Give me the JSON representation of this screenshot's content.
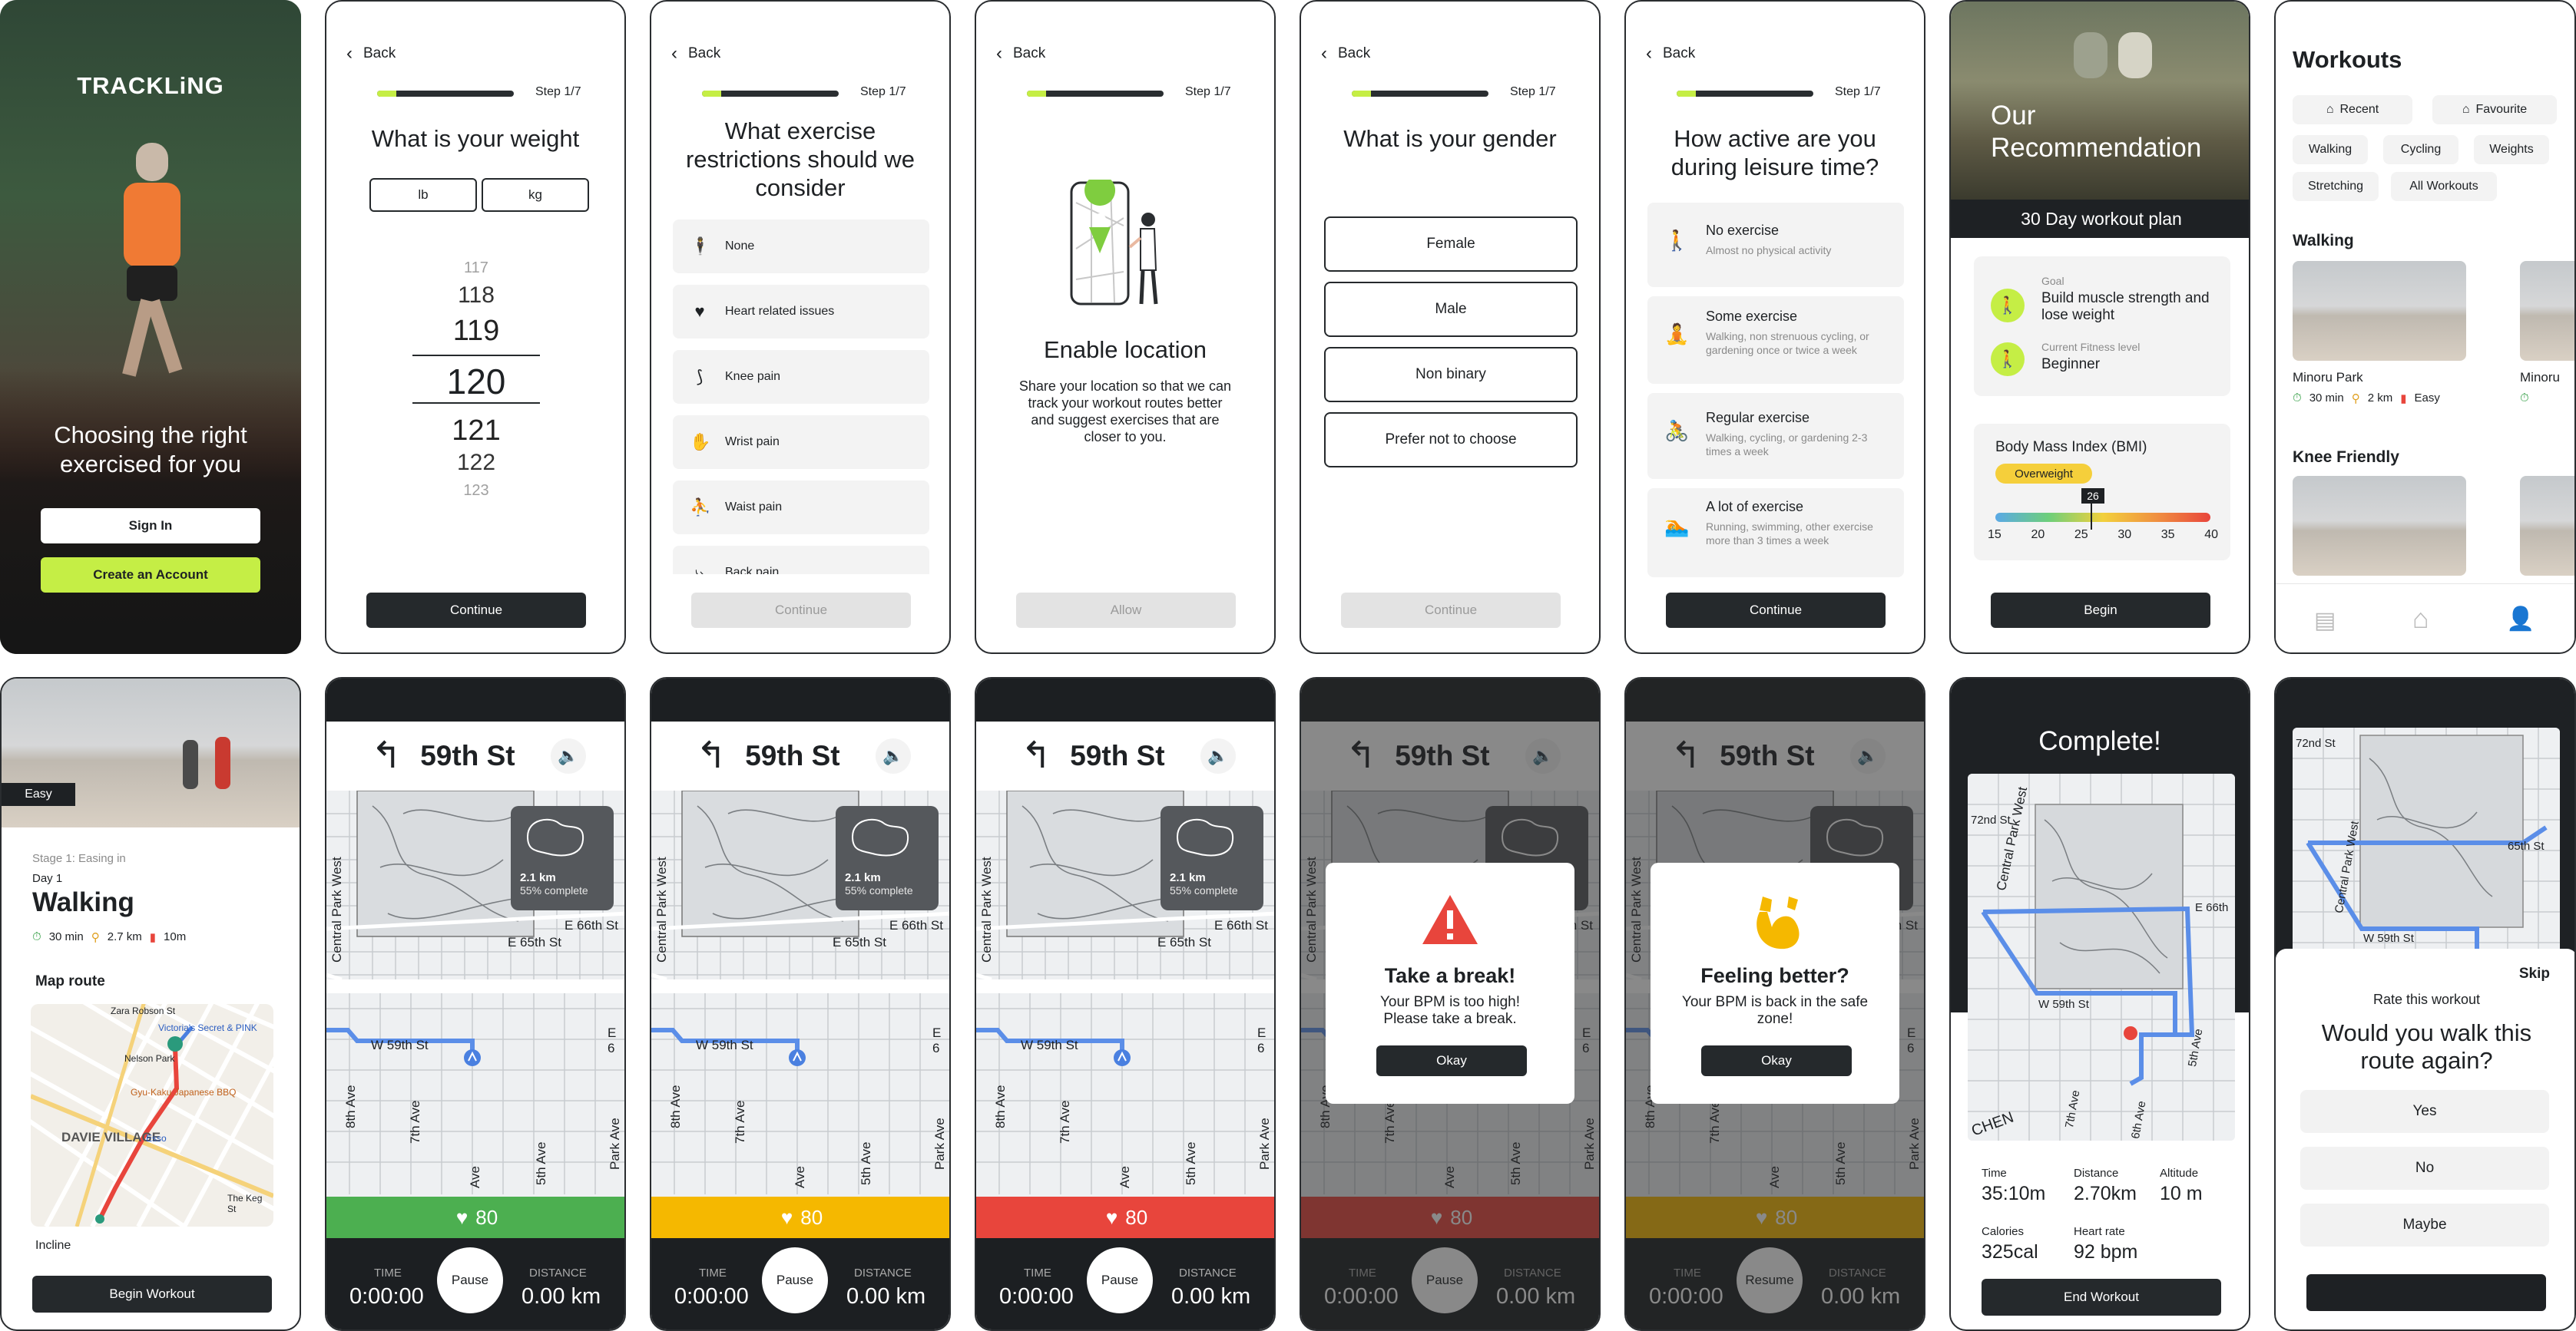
{
  "s1": {
    "brand": "TRACKLiNG",
    "headline": "Choosing the right exercised for you",
    "signin": "Sign In",
    "create": "Create an Account"
  },
  "common": {
    "back": "Back",
    "step": "Step 1/7",
    "progress_fraction": 0.14,
    "continue": "Continue"
  },
  "s2": {
    "title": "What is your weight",
    "unit_lb": "lb",
    "unit_kg": "kg",
    "wheel": [
      "117",
      "118",
      "119",
      "120",
      "121",
      "122",
      "123"
    ]
  },
  "s3": {
    "title": "What exercise restrictions should we consider",
    "options": [
      {
        "icon": "standing-person-icon",
        "label": "None"
      },
      {
        "icon": "heart-icon",
        "label": "Heart related issues"
      },
      {
        "icon": "knee-icon",
        "label": "Knee pain"
      },
      {
        "icon": "hand-icon",
        "label": "Wrist pain"
      },
      {
        "icon": "waist-icon",
        "label": "Waist pain"
      },
      {
        "icon": "back-icon",
        "label": "Back pain"
      }
    ]
  },
  "s4": {
    "title": "Enable location",
    "body": "Share your location so that we can track your workout routes better and suggest exercises that are closer to you.",
    "allow": "Allow"
  },
  "s5": {
    "title": "What is your gender",
    "options": [
      "Female",
      "Male",
      "Non binary",
      "Prefer not to choose"
    ]
  },
  "s6": {
    "title": "How active are you during leisure time?",
    "options": [
      {
        "icon": "walking-icon",
        "title": "No exercise",
        "desc": "Almost no physical activity"
      },
      {
        "icon": "stretching-icon",
        "title": "Some exercise",
        "desc": "Walking, non strenuous cycling, or gardening once or twice a week"
      },
      {
        "icon": "cycling-icon",
        "title": "Regular exercise",
        "desc": "Walking, cycling, or gardening 2-3 times a week"
      },
      {
        "icon": "swimming-icon",
        "title": "A lot of exercise",
        "desc": "Running, swimming, other exercise more than 3 times a week"
      }
    ]
  },
  "s7": {
    "title": "Our Recommendation",
    "plan": "30 Day workout plan",
    "goal_label": "Goal",
    "goal": "Build muscle strength and lose weight",
    "fit_label": "Current Fitness level",
    "fit": "Beginner",
    "bmi_title": "Body Mass Index (BMI)",
    "bmi_badge": "Overweight",
    "bmi_value": "26",
    "bmi_ticks": [
      "15",
      "20",
      "25",
      "30",
      "35",
      "40"
    ],
    "begin": "Begin"
  },
  "s8": {
    "title": "Workouts",
    "chips": [
      "Recent",
      "Favourite",
      "Walking",
      "Cycling",
      "Weights",
      "Stretching",
      "All Workouts"
    ],
    "sec1": "Walking",
    "sec2": "Knee Friendly",
    "card": {
      "name": "Minoru Park",
      "time": "30 min",
      "dist": "2 km",
      "level": "Easy"
    },
    "card2_name": "Minoru"
  },
  "s9": {
    "badge": "Easy",
    "stage": "Stage 1: Easing in",
    "day": "Day 1",
    "title": "Walking",
    "time": "30 min",
    "dist": "2.7 km",
    "level": "10m",
    "map_route": "Map route",
    "incline": "Incline",
    "begin": "Begin Workout",
    "map_labels": [
      "Zara Robson St",
      "Victoria's Secret & PINK",
      "Nelson Park",
      "Gyu-Kaku Japanese BBQ",
      "DAVIE VILLAGE",
      "Esso",
      "The Keg St"
    ]
  },
  "nav": {
    "street": "59th St",
    "mini_dist": "2.1 km",
    "mini_pct": "55% complete",
    "hr": "80",
    "time_lbl": "TIME",
    "time": "0:00:00",
    "pause": "Pause",
    "resume": "Resume",
    "dist_lbl": "DISTANCE",
    "dist": "0.00 km",
    "map_labels": [
      "Central Park West",
      "E 66th St",
      "E 65th St",
      "W 59th St",
      "8th Ave",
      "7th Ave",
      "Ave",
      "5th Ave",
      "Park Ave",
      "E 6"
    ]
  },
  "zone_colors": {
    "green": "#4caf50",
    "yellow": "#f5b800",
    "red": "#e8453c"
  },
  "s13": {
    "title": "Take a break!",
    "body": "Your BPM is too high! Please take a break.",
    "ok": "Okay"
  },
  "s14": {
    "title": "Feeling better?",
    "body": "Your BPM is back in the safe zone!",
    "ok": "Okay"
  },
  "s15": {
    "title": "Complete!",
    "stats": [
      {
        "l": "Time",
        "v": "35:10m"
      },
      {
        "l": "Distance",
        "v": "2.70km"
      },
      {
        "l": "Altitude",
        "v": "10 m"
      },
      {
        "l": "Calories",
        "v": "325cal"
      },
      {
        "l": "Heart rate",
        "v": "92 bpm"
      }
    ],
    "end": "End Workout",
    "map_labels": [
      "72nd St",
      "Central Park West",
      "W 59th St",
      "7th Ave",
      "6th Ave",
      "5th Ave",
      "E 66th",
      "CHEN"
    ]
  },
  "s16": {
    "skip": "Skip",
    "sub": "Rate this workout",
    "q": "Would you walk this route again?",
    "opts": [
      "Yes",
      "No",
      "Maybe"
    ],
    "map_labels": [
      "72nd St",
      "Central Park West",
      "W 59th St",
      "65th St"
    ]
  }
}
